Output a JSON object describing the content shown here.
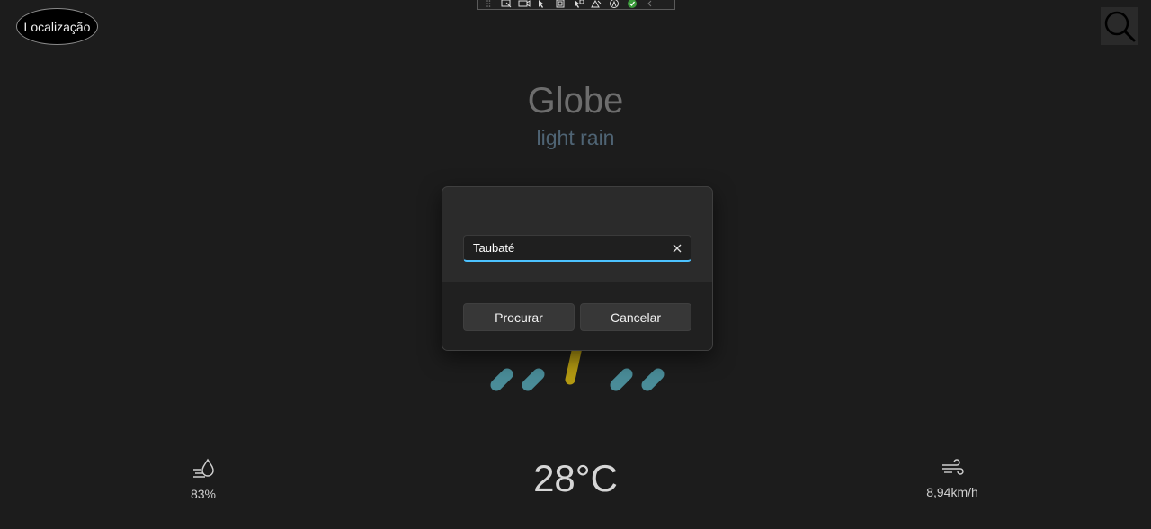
{
  "header": {
    "location_label": "Localização",
    "search_icon": "search-icon"
  },
  "debug_toolbar": {
    "icons": [
      "grip-icon",
      "select-element-icon",
      "live-preview-icon",
      "pointer-icon",
      "layout-adorner-icon",
      "track-focus-icon",
      "highlight-icon",
      "accessibility-icon",
      "check-icon",
      "collapse-icon"
    ]
  },
  "weather": {
    "city": "Globe",
    "condition": "light rain",
    "temperature": "28°C",
    "humidity": "83%",
    "wind": "8,94km/h",
    "icons": {
      "humidity": "humidity-icon",
      "wind": "wind-icon",
      "condition": "rain-thunder-icon"
    },
    "colors": {
      "rain": "#4a8c98",
      "bolt": "#b49a12",
      "city": "#6d6d6d",
      "condition": "#4f6474"
    }
  },
  "dialog": {
    "search_value": "Taubaté",
    "primary_label": "Procurar",
    "cancel_label": "Cancelar",
    "clear_icon": "close-icon",
    "accent": "#4cc2ff"
  }
}
